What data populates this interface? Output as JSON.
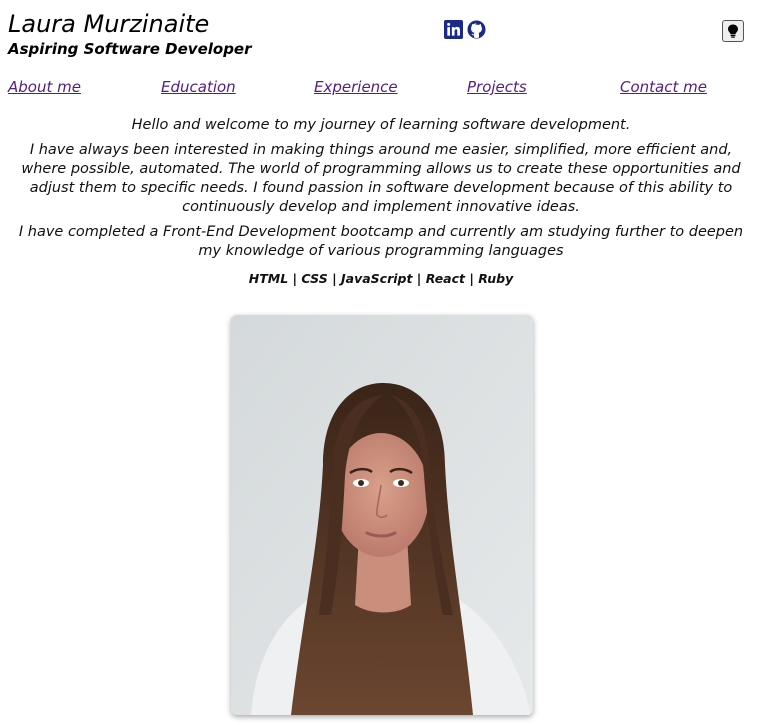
{
  "header": {
    "name": "Laura Murzinaite",
    "subtitle": "Aspiring Software Developer",
    "social": [
      {
        "icon": "linkedin-icon",
        "color": "#1b2a8a"
      },
      {
        "icon": "github-icon",
        "color": "#1b2a8a"
      }
    ],
    "theme_toggle_icon": "lightbulb-icon"
  },
  "nav": {
    "items": [
      "About me",
      "Education",
      "Experience",
      "Projects",
      "Contact me"
    ],
    "link_color": "#551a8b"
  },
  "intro": {
    "welcome": "Hello and welcome to my journey of learning software development.",
    "paragraph1": "I have always been interested in making things around me easier, simplified, more efficient and, where possible, automated. The world of programming allows us to create these opportunities and adjust them to specific needs. I found passion in software development because of this ability to continuously develop and implement innovative ideas.",
    "paragraph2": "I have completed a Front-End Development bootcamp and currently am studying further to deepen my knowledge of various programming languages",
    "skills": "HTML | CSS | JavaScript | React | Ruby"
  },
  "photo": {
    "subject": "portrait-photo"
  }
}
